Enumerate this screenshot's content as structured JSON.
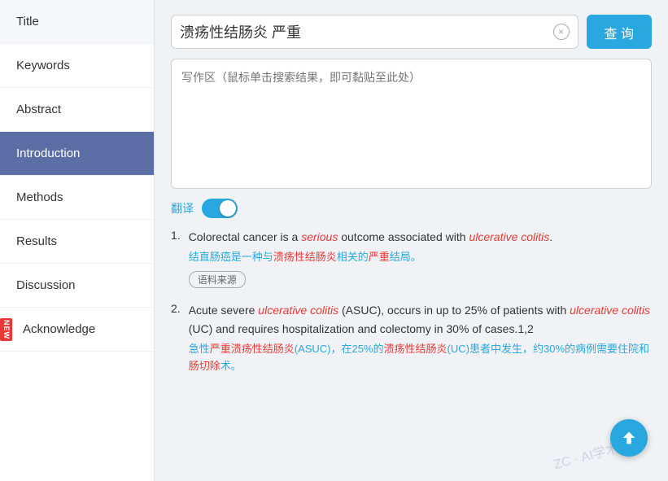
{
  "sidebar": {
    "items": [
      {
        "id": "title",
        "label": "Title",
        "active": false,
        "new": false
      },
      {
        "id": "keywords",
        "label": "Keywords",
        "active": false,
        "new": false
      },
      {
        "id": "abstract",
        "label": "Abstract",
        "active": false,
        "new": false
      },
      {
        "id": "introduction",
        "label": "Introduction",
        "active": true,
        "new": false
      },
      {
        "id": "methods",
        "label": "Methods",
        "active": false,
        "new": false
      },
      {
        "id": "results",
        "label": "Results",
        "active": false,
        "new": false
      },
      {
        "id": "discussion",
        "label": "Discussion",
        "active": false,
        "new": false
      },
      {
        "id": "acknowledge",
        "label": "Acknowledge",
        "active": false,
        "new": true
      }
    ]
  },
  "searchBar": {
    "inputValue": "溃疡性结肠炎 严重",
    "clearBtnLabel": "×",
    "queryBtnLabel": "查 询"
  },
  "writingArea": {
    "placeholder": "写作区（鼠标单击搜索结果，即可黏贴至此处）"
  },
  "translate": {
    "label": "翻译"
  },
  "results": [
    {
      "number": "1.",
      "en_parts": [
        {
          "text": "Colorectal cancer is a ",
          "style": "normal"
        },
        {
          "text": "serious",
          "style": "red-italic"
        },
        {
          "text": " outcome associated with ",
          "style": "normal"
        },
        {
          "text": "ulcerative colitis",
          "style": "red-italic"
        },
        {
          "text": ".",
          "style": "normal"
        }
      ],
      "zh": "结直肠癌是一种与溃疡性结肠炎相关的严重结局。",
      "zh_red": [
        "溃疡性结肠炎",
        "严重"
      ],
      "source": "语料来源",
      "hasSource": true
    },
    {
      "number": "2.",
      "en_parts": [
        {
          "text": "Acute severe ",
          "style": "normal"
        },
        {
          "text": "ulcerative colitis",
          "style": "red-italic"
        },
        {
          "text": " (ASUC), occurs in up to 25% of patients with ",
          "style": "normal"
        },
        {
          "text": "ulcerative colitis",
          "style": "red-italic"
        },
        {
          "text": " (UC) and requires hospitalization and colectomy in 30% of cases.1,2",
          "style": "normal"
        }
      ],
      "zh": "急性严重溃疡性结肠炎(ASUC)，在25%的溃疡性结肠炎(UC)患者中发生，约30%的病例需要住院和肠切除术。",
      "zh_red": [
        "严重溃疡性结肠炎",
        "溃疡性结肠炎",
        "肠切除"
      ],
      "hasSource": false
    }
  ],
  "scrollUpBtn": "↑",
  "watermark": "ZC · AI学术"
}
